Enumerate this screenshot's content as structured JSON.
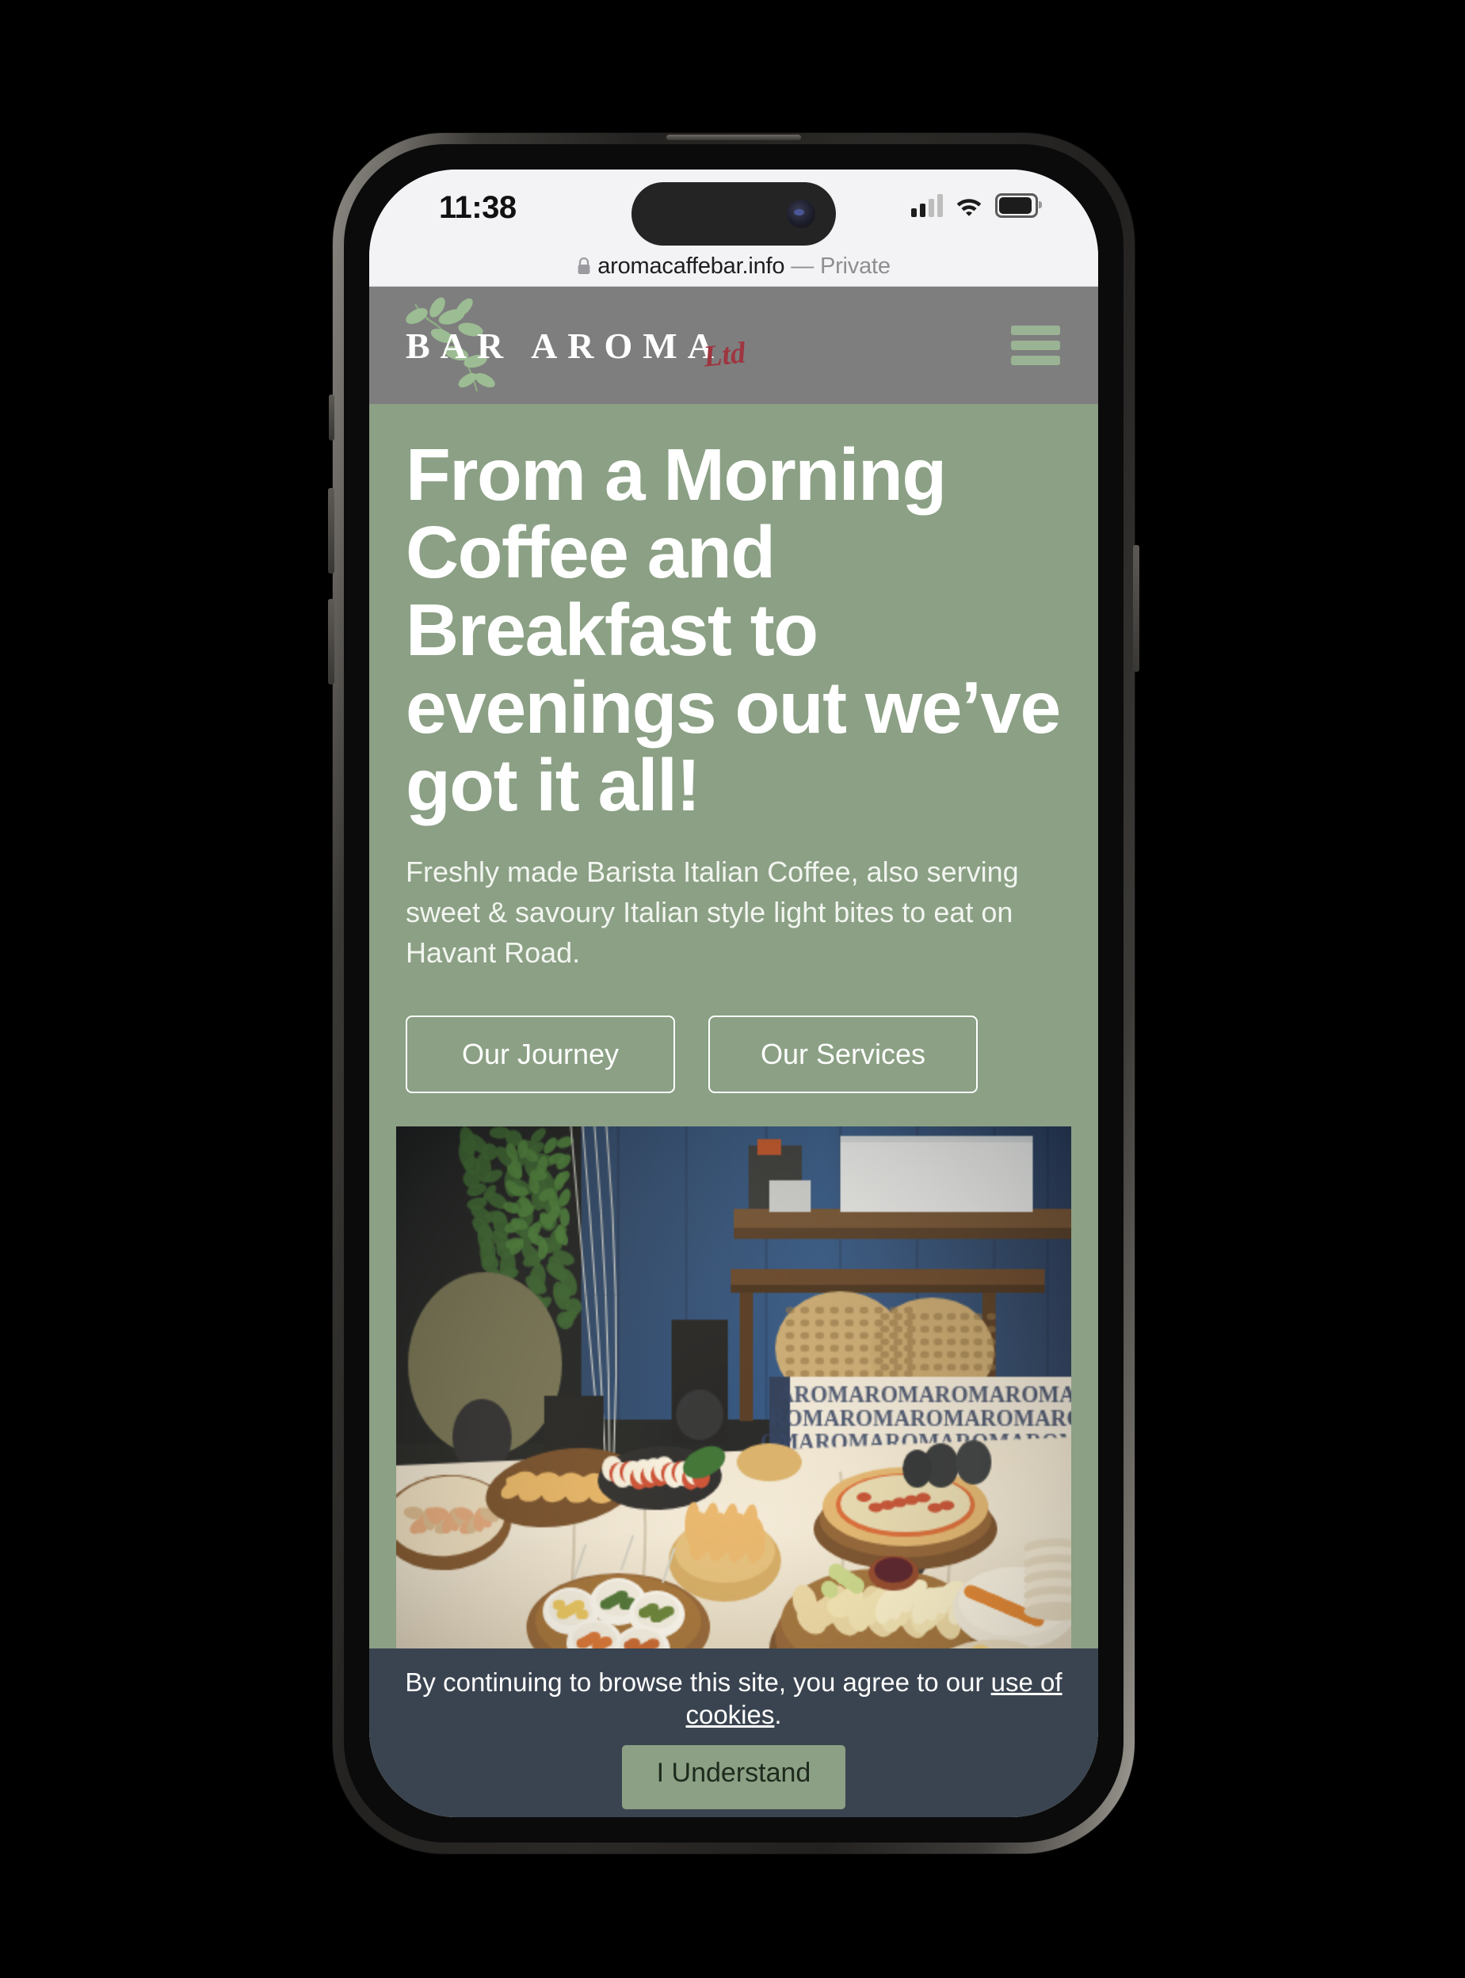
{
  "device": {
    "status_bar": {
      "time": "11:38",
      "cellular_icon": "cellular-signal-icon",
      "cellular_bars_filled": 2,
      "cellular_bars_total": 4,
      "wifi_icon": "wifi-icon",
      "battery_icon": "battery-icon",
      "battery_level_percent": 85
    }
  },
  "browser": {
    "lock_icon": "lock-icon",
    "url": "aromacaffebar.info",
    "private_label": "— Private"
  },
  "site": {
    "header": {
      "logo_text": "BAR AROMA",
      "logo_suffix": "Ltd",
      "leaf_icon": "olive-branch-icon",
      "menu_icon": "hamburger-menu-icon"
    },
    "hero": {
      "title": "From a Morning Coffee and Breakfast to evenings out we’ve got it all!",
      "subtitle": "Freshly made Barista Italian Coffee, also serving sweet & savoury Italian style light bites to eat on Havant Road.",
      "buttons": [
        {
          "label": "Our Journey"
        },
        {
          "label": "Our Services"
        }
      ],
      "photo_alt": "buffet-table-photo"
    },
    "cookie_banner": {
      "text_before_link": "By continuing to browse this site, you agree to our ",
      "link_label": "use of cookies",
      "text_after_link": ".",
      "accept_label": "I Understand"
    }
  },
  "colors": {
    "page_background": "#000000",
    "browser_chrome": "#f3f3f5",
    "site_header_gray": "#7e7e7e",
    "hero_sage_green": "#8ba084",
    "menu_icon_green": "#9ab394",
    "logo_ltd_red": "#9e3640",
    "cookie_banner_slate": "#3a4450",
    "cookie_button_green": "#8ba084",
    "text_white": "#ffffff",
    "url_text": "#1d1d1f",
    "url_private_gray": "#8e8e93"
  }
}
